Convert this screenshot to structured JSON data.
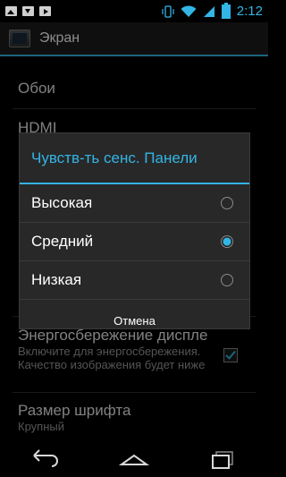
{
  "status_bar": {
    "time": "2:12",
    "left_icons": [
      "image-icon",
      "download-icon",
      "play-store-icon"
    ],
    "right_icons": [
      "vibrate-icon",
      "wifi-icon",
      "signal-icon",
      "battery-icon"
    ],
    "accent": "#33b5e5"
  },
  "action_bar": {
    "title": "Экран",
    "icon": "display-settings-icon"
  },
  "settings": {
    "wallpaper": "Обои",
    "hdmi": "HDMI",
    "power_save_title": "Энергосбережение диспле",
    "power_save_summary": "Включите для энергосбережения. Качество изображения будет ниже",
    "power_save_checked": true,
    "font_size_title": "Размер шрифта",
    "font_size_summary": "Крупный"
  },
  "dialog": {
    "title": "Чувств-ть сенс. Панели",
    "options": [
      {
        "label": "Высокая",
        "selected": false
      },
      {
        "label": "Средний",
        "selected": true
      },
      {
        "label": "Низкая",
        "selected": false
      }
    ],
    "cancel_label": "Отмена"
  },
  "nav_bar": {
    "buttons": [
      "back-icon",
      "home-icon",
      "recents-icon"
    ]
  }
}
